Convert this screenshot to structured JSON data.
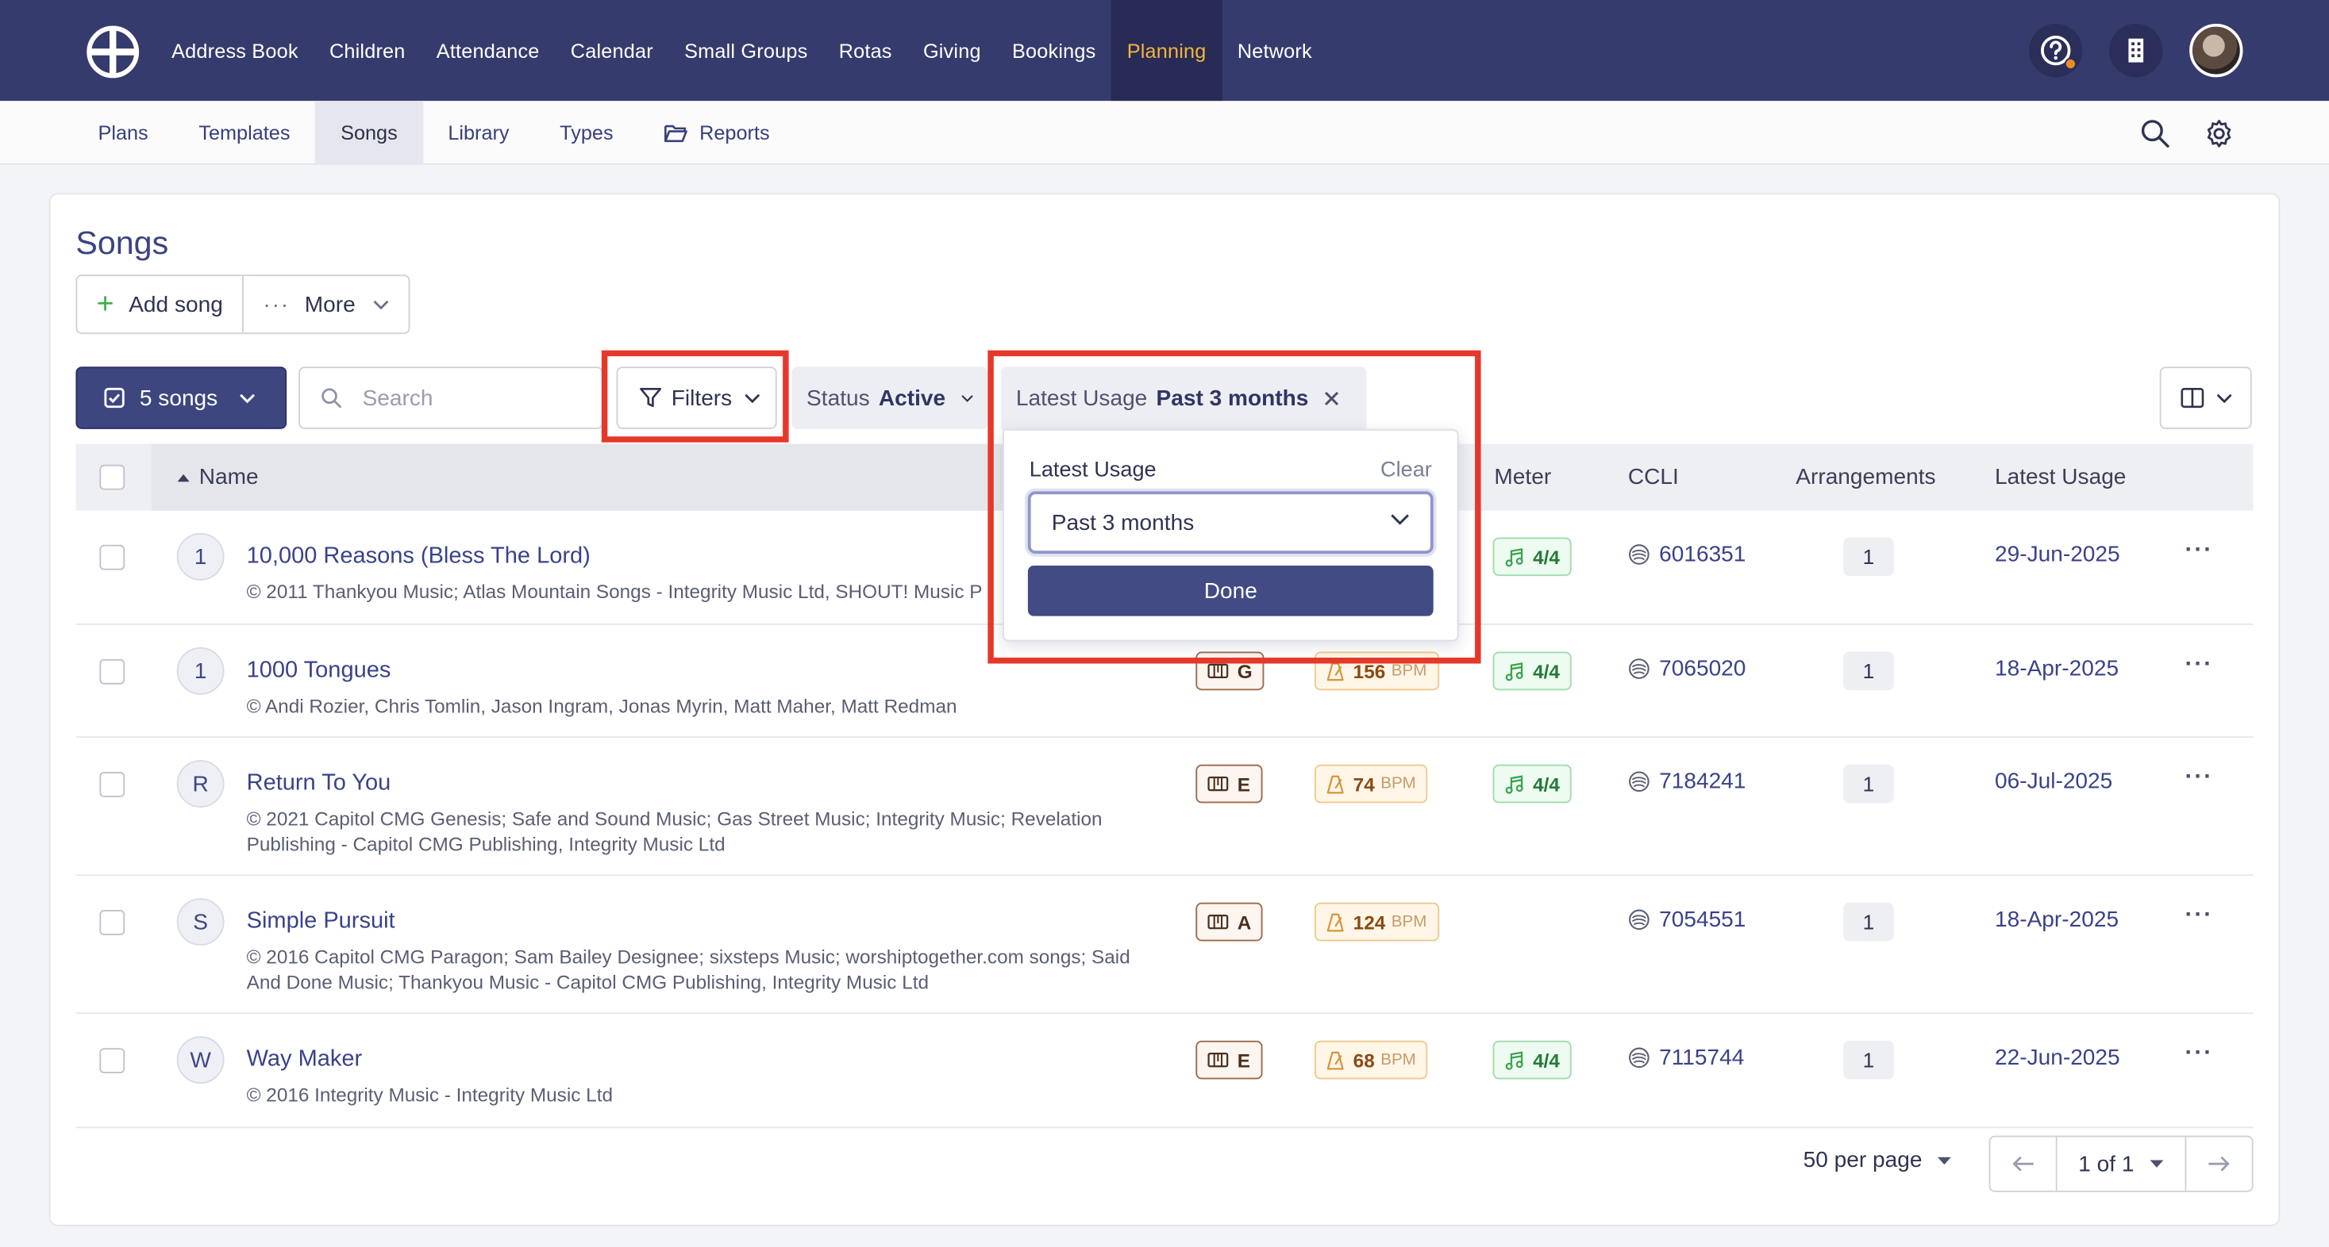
{
  "topnav": {
    "items": [
      {
        "label": "Address Book"
      },
      {
        "label": "Children"
      },
      {
        "label": "Attendance"
      },
      {
        "label": "Calendar"
      },
      {
        "label": "Small Groups"
      },
      {
        "label": "Rotas"
      },
      {
        "label": "Giving"
      },
      {
        "label": "Bookings"
      },
      {
        "label": "Planning",
        "active": true
      },
      {
        "label": "Network"
      }
    ],
    "icons": [
      "help-icon",
      "building-icon",
      "avatar"
    ]
  },
  "subnav": {
    "items": [
      {
        "label": "Plans"
      },
      {
        "label": "Templates"
      },
      {
        "label": "Songs",
        "active": true
      },
      {
        "label": "Library"
      },
      {
        "label": "Types"
      },
      {
        "label": "Reports",
        "icon": "folder-open-icon"
      }
    ],
    "icons": [
      "search-icon",
      "settings-gear-icon"
    ]
  },
  "page": {
    "title": "Songs",
    "add_label": "Add song",
    "more_label": "More"
  },
  "toolbar": {
    "selection_label": "5 songs",
    "search_placeholder": "Search",
    "filters_label": "Filters",
    "status_key": "Status",
    "status_value": "Active",
    "usage_key": "Latest Usage",
    "usage_value": "Past 3 months"
  },
  "popover": {
    "label": "Latest Usage",
    "clear_label": "Clear",
    "selected": "Past 3 months",
    "done_label": "Done"
  },
  "table": {
    "columns": {
      "name": "Name",
      "meter": "Meter",
      "ccli": "CCLI",
      "arrangements": "Arrangements",
      "latest_usage": "Latest Usage"
    },
    "rows": [
      {
        "letter": "1",
        "title": "10,000 Reasons (Bless The Lord)",
        "copyright": "© 2011 Thankyou Music; Atlas Mountain Songs - Integrity Music Ltd, SHOUT! Music P",
        "key": "",
        "bpm": "",
        "meter": "4/4",
        "ccli": "6016351",
        "arrangements": "1",
        "latest_usage": "29-Jun-2025"
      },
      {
        "letter": "1",
        "title": "1000 Tongues",
        "copyright": "© Andi Rozier, Chris Tomlin, Jason Ingram, Jonas Myrin, Matt Maher, Matt Redman",
        "key": "G",
        "bpm": "156",
        "meter": "4/4",
        "ccli": "7065020",
        "arrangements": "1",
        "latest_usage": "18-Apr-2025"
      },
      {
        "letter": "R",
        "title": "Return To You",
        "copyright": "© 2021 Capitol CMG Genesis; Safe and Sound Music; Gas Street Music; Integrity Music; Revelation Publishing - Capitol CMG Publishing, Integrity Music Ltd",
        "key": "E",
        "bpm": "74",
        "meter": "4/4",
        "ccli": "7184241",
        "arrangements": "1",
        "latest_usage": "06-Jul-2025"
      },
      {
        "letter": "S",
        "title": "Simple Pursuit",
        "copyright": "© 2016 Capitol CMG Paragon; Sam Bailey Designee; sixsteps Music; worshiptogether.com songs; Said And Done Music; Thankyou Music - Capitol CMG Publishing, Integrity Music Ltd",
        "key": "A",
        "bpm": "124",
        "meter": "",
        "ccli": "7054551",
        "arrangements": "1",
        "latest_usage": "18-Apr-2025"
      },
      {
        "letter": "W",
        "title": "Way Maker",
        "copyright": "© 2016 Integrity Music - Integrity Music Ltd",
        "key": "E",
        "bpm": "68",
        "meter": "4/4",
        "ccli": "7115744",
        "arrangements": "1",
        "latest_usage": "22-Jun-2025"
      }
    ],
    "bpm_unit": "BPM"
  },
  "pagination": {
    "per_page_label": "50 per page",
    "page_label": "1 of 1"
  },
  "colors": {
    "nav_bg": "#363b6e",
    "nav_active": "#f3b43a",
    "primary": "#434b85",
    "highlight": "#e5382a"
  }
}
